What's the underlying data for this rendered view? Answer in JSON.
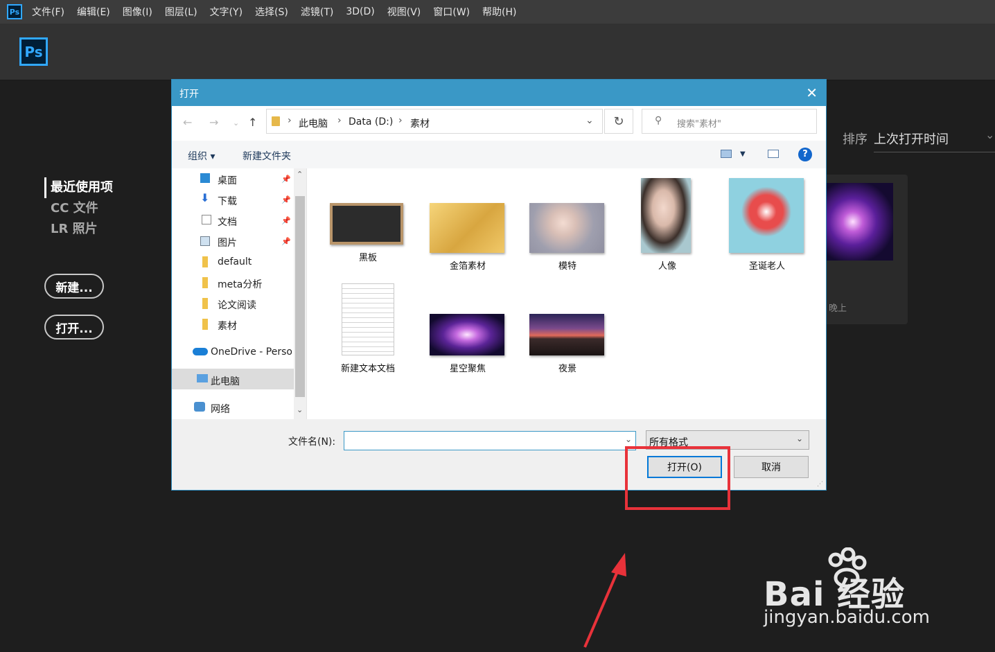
{
  "app": {
    "mini_logo": "Ps",
    "logo": "Ps",
    "menu": [
      "文件(F)",
      "编辑(E)",
      "图像(I)",
      "图层(L)",
      "文字(Y)",
      "选择(S)",
      "滤镜(T)",
      "3D(D)",
      "视图(V)",
      "窗口(W)",
      "帮助(H)"
    ]
  },
  "home": {
    "nav": [
      "最近使用项",
      "CC 文件",
      "LR 照片"
    ],
    "new_button": "新建...",
    "open_button": "打开...",
    "sort_label": "排序",
    "sort_value": "上次打开时间",
    "recent_card_time": "晚上"
  },
  "dialog": {
    "title": "打开",
    "breadcrumb": [
      "此电脑",
      "Data (D:)",
      "素材"
    ],
    "search_placeholder": "搜索\"素材\"",
    "organize": "组织 ▾",
    "new_folder": "新建文件夹",
    "help": "?",
    "sidebar": [
      {
        "label": "桌面",
        "icon": "desktop-icon",
        "pinned": true
      },
      {
        "label": "下载",
        "icon": "download-icon",
        "pinned": true
      },
      {
        "label": "文档",
        "icon": "document-icon",
        "pinned": true
      },
      {
        "label": "图片",
        "icon": "pictures-icon",
        "pinned": true
      },
      {
        "label": "default",
        "icon": "folder-icon",
        "pinned": false
      },
      {
        "label": "meta分析",
        "icon": "folder-icon",
        "pinned": false
      },
      {
        "label": "论文阅读",
        "icon": "folder-icon",
        "pinned": false
      },
      {
        "label": "素材",
        "icon": "folder-icon",
        "pinned": false
      },
      {
        "label": "OneDrive - Perso",
        "icon": "cloud-icon",
        "pinned": false
      },
      {
        "label": "此电脑",
        "icon": "computer-icon",
        "pinned": false,
        "selected": true
      },
      {
        "label": "网络",
        "icon": "network-icon",
        "pinned": false
      }
    ],
    "files": [
      "黑板",
      "金箔素材",
      "模特",
      "人像",
      "圣诞老人",
      "新建文本文档",
      "星空聚焦",
      "夜景"
    ],
    "filename_label": "文件名(N):",
    "filename_value": "",
    "filetype": "所有格式",
    "open_button": "打开(O)",
    "cancel_button": "取消"
  },
  "watermark": {
    "logo_text": "Bai  经验",
    "url": "jingyan.baidu.com"
  },
  "colors": {
    "accent": "#3a98c6",
    "ps_blue": "#31a8ff",
    "highlight": "#e8323a"
  }
}
